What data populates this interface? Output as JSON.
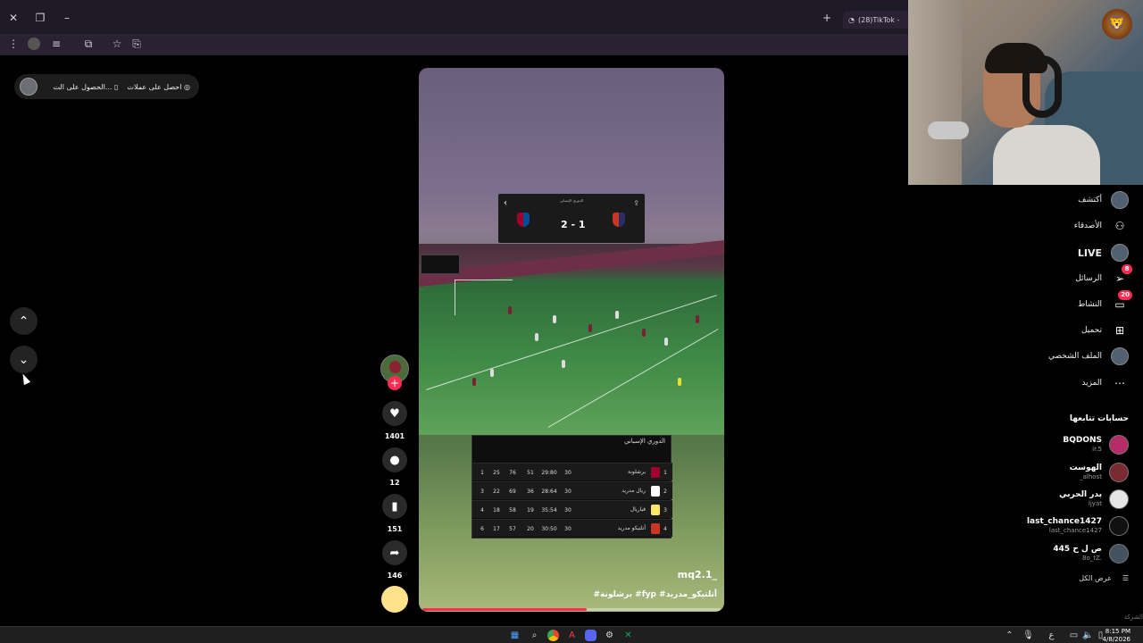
{
  "browser": {
    "tab_title": "(28)TikTok -",
    "colors": {
      "titlebar": "#1e1a26",
      "toolbar": "#2a2233"
    }
  },
  "top_pill": {
    "coins_label": "احصل على عملات",
    "app_label": "الحصول على الت..."
  },
  "video": {
    "scoreboard": {
      "header": "الدوري الإسباني",
      "score": "2 - 1"
    },
    "standings": {
      "title": "الدوري الإسباني",
      "rows": [
        {
          "rank": "1",
          "team": "برشلونة",
          "played": "30",
          "gd": "29:80",
          "w": "51",
          "pts": "76",
          "col5": "25",
          "col6": "1",
          "color": "#a1002e"
        },
        {
          "rank": "2",
          "team": "ريال مدريد",
          "played": "30",
          "gd": "28:64",
          "w": "36",
          "pts": "69",
          "col5": "22",
          "col6": "3",
          "color": "#ffffff"
        },
        {
          "rank": "3",
          "team": "فياريال",
          "played": "30",
          "gd": "35:54",
          "w": "19",
          "pts": "58",
          "col5": "18",
          "col6": "4",
          "color": "#ffe667"
        },
        {
          "rank": "4",
          "team": "أتلتيكو مدريد",
          "played": "30",
          "gd": "30:50",
          "w": "20",
          "pts": "57",
          "col5": "17",
          "col6": "6",
          "color": "#cb3524"
        }
      ]
    },
    "username": "mq2.1_",
    "hashtags": "#برشلونة #fyp #أتلتيكو_مدريد",
    "progress": 0.55
  },
  "actions": {
    "likes": "1401",
    "comments": "12",
    "saves": "151",
    "shares": "146"
  },
  "sidebar": {
    "items": [
      {
        "label": "أكتشف",
        "icon": "explore-icon"
      },
      {
        "label": "الأصدقاء",
        "icon": "friends-icon"
      },
      {
        "label": "LIVE",
        "icon": "live-icon"
      },
      {
        "label": "الرسائل",
        "icon": "messages-icon",
        "badge": "8"
      },
      {
        "label": "النشاط",
        "icon": "activity-icon",
        "badge": "20"
      },
      {
        "label": "تحميل",
        "icon": "upload-icon"
      },
      {
        "label": "الملف الشخصي",
        "icon": "profile-icon"
      },
      {
        "label": "المزيد",
        "icon": "more-icon"
      }
    ],
    "following_heading": "حسابات تتابعها",
    "accounts": [
      {
        "name": "BQDONS",
        "handle": "ir.5"
      },
      {
        "name": "الهوست",
        "handle": "_alhost"
      },
      {
        "name": "بدر الحربي",
        "handle": "ljyat"
      },
      {
        "name": "last_chance1427",
        "handle": "last_chance1427"
      },
      {
        "name": "ص ل ح 445",
        "handle": "8o_tZ."
      }
    ],
    "see_all": "عرض الكل",
    "company": "الشركة"
  },
  "taskbar": {
    "time": "8:15 PM",
    "date": "4/8/2026",
    "lang": "ع"
  }
}
